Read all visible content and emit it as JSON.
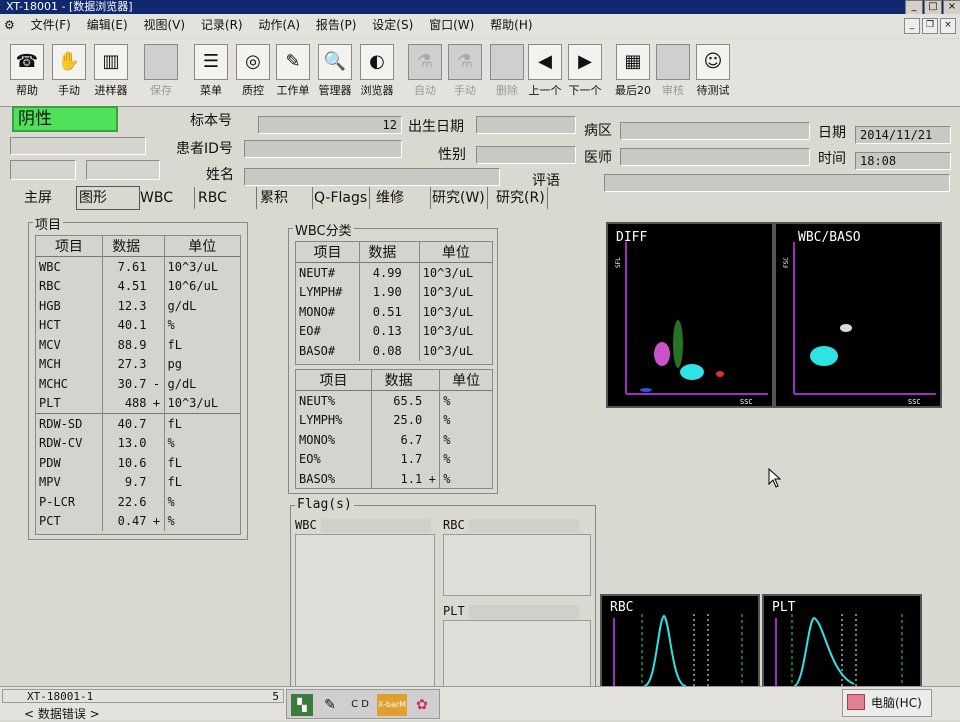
{
  "window": {
    "title": "XT-18001 - [数据浏览器]",
    "menu": [
      "文件(F)",
      "编辑(E)",
      "视图(V)",
      "记录(R)",
      "动作(A)",
      "报告(P)",
      "设定(S)",
      "窗口(W)",
      "帮助(H)"
    ]
  },
  "toolbar": {
    "buttons": [
      {
        "label": "帮助",
        "icon": "help-icon"
      },
      {
        "label": "手动",
        "icon": "manual-icon"
      },
      {
        "label": "进样器",
        "icon": "sampler-icon"
      },
      {
        "label": "保存",
        "icon": "save-icon"
      },
      {
        "label": "菜单",
        "icon": "menu-icon"
      },
      {
        "label": "质控",
        "icon": "qc-icon"
      },
      {
        "label": "工作单",
        "icon": "worksheet-icon"
      },
      {
        "label": "管理器",
        "icon": "manager-icon"
      },
      {
        "label": "浏览器",
        "icon": "browser-icon"
      },
      {
        "label": "自动",
        "icon": "auto-icon"
      },
      {
        "label": "手动",
        "icon": "manual2-icon"
      },
      {
        "label": "删除",
        "icon": "delete-icon"
      },
      {
        "label": "上一个",
        "icon": "prev-icon"
      },
      {
        "label": "下一个",
        "icon": "next-icon"
      },
      {
        "label": "最后20",
        "icon": "last20-icon"
      },
      {
        "label": "审核",
        "icon": "review-icon"
      },
      {
        "label": "待测试",
        "icon": "pending-icon"
      }
    ]
  },
  "header": {
    "status": "阴性",
    "sample_no_label": "标本号",
    "sample_no": "12",
    "dob_label": "出生日期",
    "dob": "",
    "ward_label": "病区",
    "ward": "",
    "date_label": "日期",
    "date": "2014/11/21",
    "patient_id_label": "患者ID号",
    "patient_id": "",
    "sex_label": "性别",
    "sex": "",
    "doctor_label": "医师",
    "doctor": "",
    "time_label": "时间",
    "time": "18:08",
    "name_label": "姓名",
    "name": "",
    "comment_label": "评语",
    "comment": ""
  },
  "tabs": [
    "主屏",
    "图形",
    "WBC",
    "RBC",
    "累积",
    "Q-Flags",
    "维修",
    "研究(W)",
    "研究(R)"
  ],
  "items": {
    "group_title": "项目",
    "headers": [
      "项目",
      "数据",
      "单位"
    ],
    "rows1": [
      {
        "item": "WBC",
        "value": "7.61",
        "flag": "",
        "unit": "10^3/uL"
      },
      {
        "item": "RBC",
        "value": "4.51",
        "flag": "",
        "unit": "10^6/uL"
      },
      {
        "item": "HGB",
        "value": "12.3",
        "flag": "",
        "unit": "g/dL"
      },
      {
        "item": "HCT",
        "value": "40.1",
        "flag": "",
        "unit": "%"
      },
      {
        "item": "MCV",
        "value": "88.9",
        "flag": "",
        "unit": "fL"
      },
      {
        "item": "MCH",
        "value": "27.3",
        "flag": "",
        "unit": "pg"
      },
      {
        "item": "MCHC",
        "value": "30.7",
        "flag": "-",
        "unit": "g/dL"
      },
      {
        "item": "PLT",
        "value": "488",
        "flag": "+",
        "unit": "10^3/uL"
      }
    ],
    "rows2": [
      {
        "item": "RDW-SD",
        "value": "40.7",
        "flag": "",
        "unit": "fL"
      },
      {
        "item": "RDW-CV",
        "value": "13.0",
        "flag": "",
        "unit": "%"
      },
      {
        "item": "PDW",
        "value": "10.6",
        "flag": "",
        "unit": "fL"
      },
      {
        "item": "MPV",
        "value": "9.7",
        "flag": "",
        "unit": "fL"
      },
      {
        "item": "P-LCR",
        "value": "22.6",
        "flag": "",
        "unit": "%"
      },
      {
        "item": "PCT",
        "value": "0.47",
        "flag": "+",
        "unit": "%"
      }
    ]
  },
  "wbc_diff": {
    "group_title": "WBC分类",
    "headers": [
      "项目",
      "数据",
      "单位"
    ],
    "abs_rows": [
      {
        "item": "NEUT#",
        "value": "4.99",
        "flag": "",
        "unit": "10^3/uL"
      },
      {
        "item": "LYMPH#",
        "value": "1.90",
        "flag": "",
        "unit": "10^3/uL"
      },
      {
        "item": "MONO#",
        "value": "0.51",
        "flag": "",
        "unit": "10^3/uL"
      },
      {
        "item": "EO#",
        "value": "0.13",
        "flag": "",
        "unit": "10^3/uL"
      },
      {
        "item": "BASO#",
        "value": "0.08",
        "flag": "",
        "unit": "10^3/uL"
      }
    ],
    "pct_rows": [
      {
        "item": "NEUT%",
        "value": "65.5",
        "flag": "",
        "unit": "%"
      },
      {
        "item": "LYMPH%",
        "value": "25.0",
        "flag": "",
        "unit": "%"
      },
      {
        "item": "MONO%",
        "value": "6.7",
        "flag": "",
        "unit": "%"
      },
      {
        "item": "EO%",
        "value": "1.7",
        "flag": "",
        "unit": "%"
      },
      {
        "item": "BASO%",
        "value": "1.1",
        "flag": "+",
        "unit": "%"
      }
    ]
  },
  "flags": {
    "group_title": "Flag(s)",
    "wbc_label": "WBC",
    "rbc_label": "RBC",
    "plt_label": "PLT"
  },
  "plots": {
    "diff_title": "DIFF",
    "diff_y": "SFL",
    "diff_x": "SSC",
    "baso_title": "WBC/BASO",
    "baso_y": "FSC",
    "baso_x": "SSC",
    "rbc_title": "RBC",
    "plt_title": "PLT"
  },
  "status": {
    "instrument": "XT-18001-1",
    "count": "5",
    "message": "< 数据错误 >",
    "connection": "电脑(HC)",
    "tray_icons": [
      "tray-device-icon",
      "tray-syringe-icon",
      "tray-cd-icon",
      "tray-xbarm-icon",
      "tray-cells-icon"
    ],
    "tray_xbarm_label": "X-barM",
    "tray_cd_label": "C D"
  },
  "colors": {
    "negative_bg": "#50e05a",
    "plot_bg": "#000000",
    "axis": "#9c2fc0",
    "cyan": "#2fe3e3",
    "magenta": "#e05ce0",
    "green": "#46d046"
  }
}
